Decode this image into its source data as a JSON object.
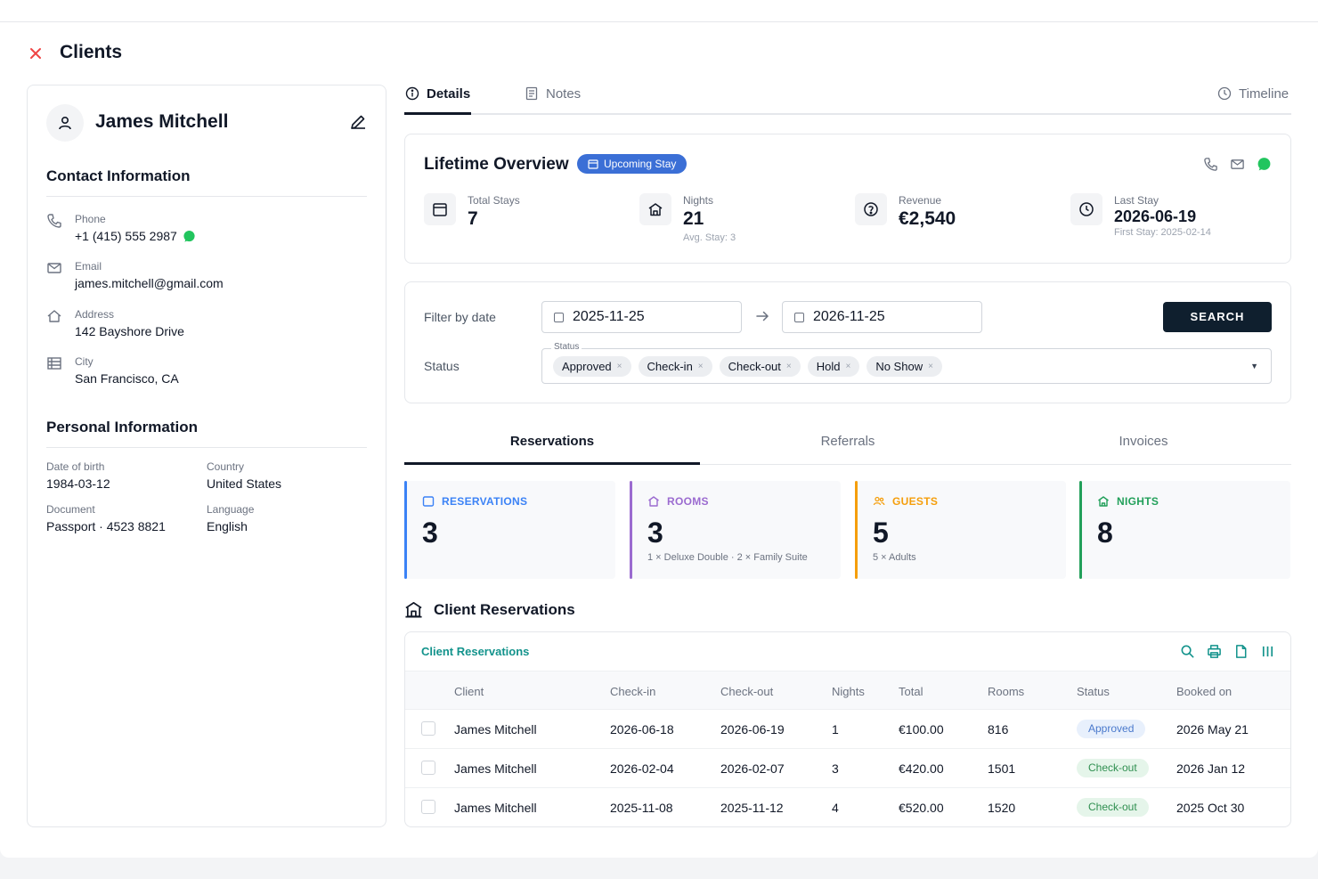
{
  "page": {
    "title": "Clients"
  },
  "client": {
    "name": "James Mitchell",
    "contact_title": "Contact Information",
    "phone_label": "Phone",
    "phone": "+1 (415) 555 2987",
    "email_label": "Email",
    "email": "james.mitchell@gmail.com",
    "address_label": "Address",
    "address": "142 Bayshore Drive",
    "city_label": "City",
    "city": "San Francisco, CA",
    "personal_title": "Personal Information",
    "dob_label": "Date of birth",
    "dob": "1984-03-12",
    "country_label": "Country",
    "country": "United States",
    "document_label": "Document",
    "document": "Passport · 4523 8821",
    "language_label": "Language",
    "language": "English"
  },
  "tabs": {
    "details": "Details",
    "notes": "Notes",
    "timeline": "Timeline"
  },
  "overview": {
    "title": "Lifetime Overview",
    "badge": "Upcoming Stay",
    "total_stays_label": "Total Stays",
    "total_stays": "7",
    "nights_label": "Nights",
    "nights": "21",
    "nights_sub": "Avg. Stay: 3",
    "revenue_label": "Revenue",
    "revenue": "€2,540",
    "last_stay_label": "Last Stay",
    "last_stay": "2026-06-19",
    "last_stay_sub": "First Stay: 2025-02-14"
  },
  "filter": {
    "date_label": "Filter by date",
    "from": "2025-11-25",
    "to": "2026-11-25",
    "search": "SEARCH",
    "status_label": "Status",
    "status_legend": "Status",
    "chips": [
      "Approved",
      "Check-in",
      "Check-out",
      "Hold",
      "No Show"
    ],
    "chip_remove": "×",
    "caret": "▼"
  },
  "subtabs": {
    "reservations": "Reservations",
    "referrals": "Referrals",
    "invoices": "Invoices"
  },
  "summary": {
    "reservations_label": "RESERVATIONS",
    "reservations": "3",
    "rooms_label": "ROOMS",
    "rooms": "3",
    "rooms_sub": "1 × Deluxe Double · 2 × Family Suite",
    "guests_label": "GUESTS",
    "guests": "5",
    "guests_sub": "5 × Adults",
    "nights_label": "NIGHTS",
    "nights": "8",
    "colors": {
      "reservations": "#3b82f6",
      "rooms": "#9b6bd0",
      "guests": "#f59e0b",
      "nights": "#22a05a"
    }
  },
  "reservations": {
    "heading": "Client Reservations",
    "table_title": "Client Reservations",
    "columns": [
      "Client",
      "Check-in",
      "Check-out",
      "Nights",
      "Total",
      "Rooms",
      "Status",
      "Booked on"
    ],
    "rows": [
      {
        "client": "James Mitchell",
        "checkin": "2026-06-18",
        "checkout": "2026-06-19",
        "nights": "1",
        "total": "€100.00",
        "rooms": "816",
        "status": "Approved",
        "booked": "2026 May 21"
      },
      {
        "client": "James Mitchell",
        "checkin": "2026-02-04",
        "checkout": "2026-02-07",
        "nights": "3",
        "total": "€420.00",
        "rooms": "1501",
        "status": "Check-out",
        "booked": "2026 Jan 12"
      },
      {
        "client": "James Mitchell",
        "checkin": "2025-11-08",
        "checkout": "2025-11-12",
        "nights": "4",
        "total": "€520.00",
        "rooms": "1520",
        "status": "Check-out",
        "booked": "2025 Oct 30"
      }
    ]
  }
}
